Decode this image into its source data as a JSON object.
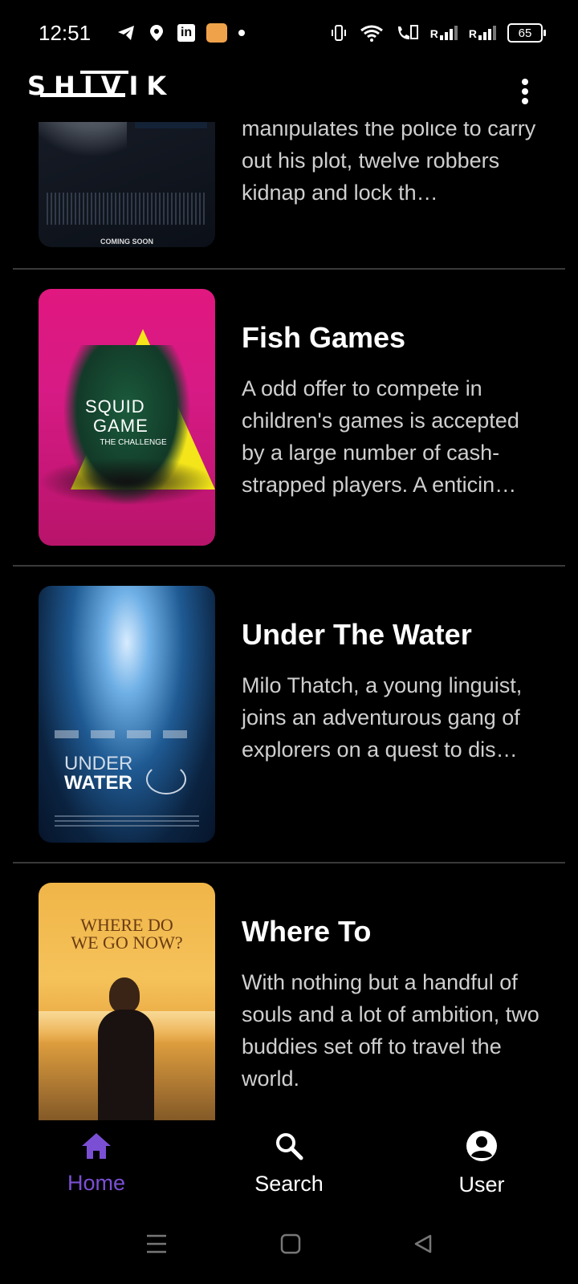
{
  "status_bar": {
    "time": "12:51",
    "battery": "65",
    "signal_label_1": "R",
    "signal_label_2": "R",
    "icons": [
      "telegram-icon",
      "location-icon",
      "linkedin-icon",
      "amazon-icon",
      "dot-icon",
      "vibrate-icon",
      "wifi-icon",
      "volte-call-icon",
      "signal-icon",
      "signal-icon",
      "battery-icon"
    ]
  },
  "app_bar": {
    "logo": "SHIVIK",
    "menu_icon": "more-vert-icon"
  },
  "movies": [
    {
      "title": "",
      "description": "manipulates the police to carry out his plot, twelve robbers kidnap and lock th…",
      "poster_text": "COMING SOON"
    },
    {
      "title": "Fish Games",
      "description": "A odd offer to compete in children's games is accepted by a large number of cash-strapped players. A enticin…",
      "poster_text_1": "SQUID",
      "poster_text_2": "GAME",
      "poster_text_3": "THE CHALLENGE"
    },
    {
      "title": "Under The Water",
      "description": "Milo Thatch, a young linguist, joins an adventurous gang of explorers on a quest to dis…",
      "poster_text_1": "UNDER",
      "poster_text_2": "WATER"
    },
    {
      "title": "Where To",
      "description": "With nothing but a handful of souls and a lot of ambition, two buddies set off to travel the world.",
      "poster_text_1": "WHERE DO",
      "poster_text_2": "WE GO NOW?"
    }
  ],
  "bottom_nav": {
    "items": [
      {
        "label": "Home",
        "icon": "home-icon",
        "active": true
      },
      {
        "label": "Search",
        "icon": "search-icon",
        "active": false
      },
      {
        "label": "User",
        "icon": "account-circle-icon",
        "active": false
      }
    ]
  },
  "system_nav": {
    "icons": [
      "recents-icon",
      "home-square-icon",
      "back-triangle-icon"
    ]
  },
  "colors": {
    "background": "#000000",
    "accent": "#7b4fd4",
    "divider": "#3a3a3a"
  }
}
